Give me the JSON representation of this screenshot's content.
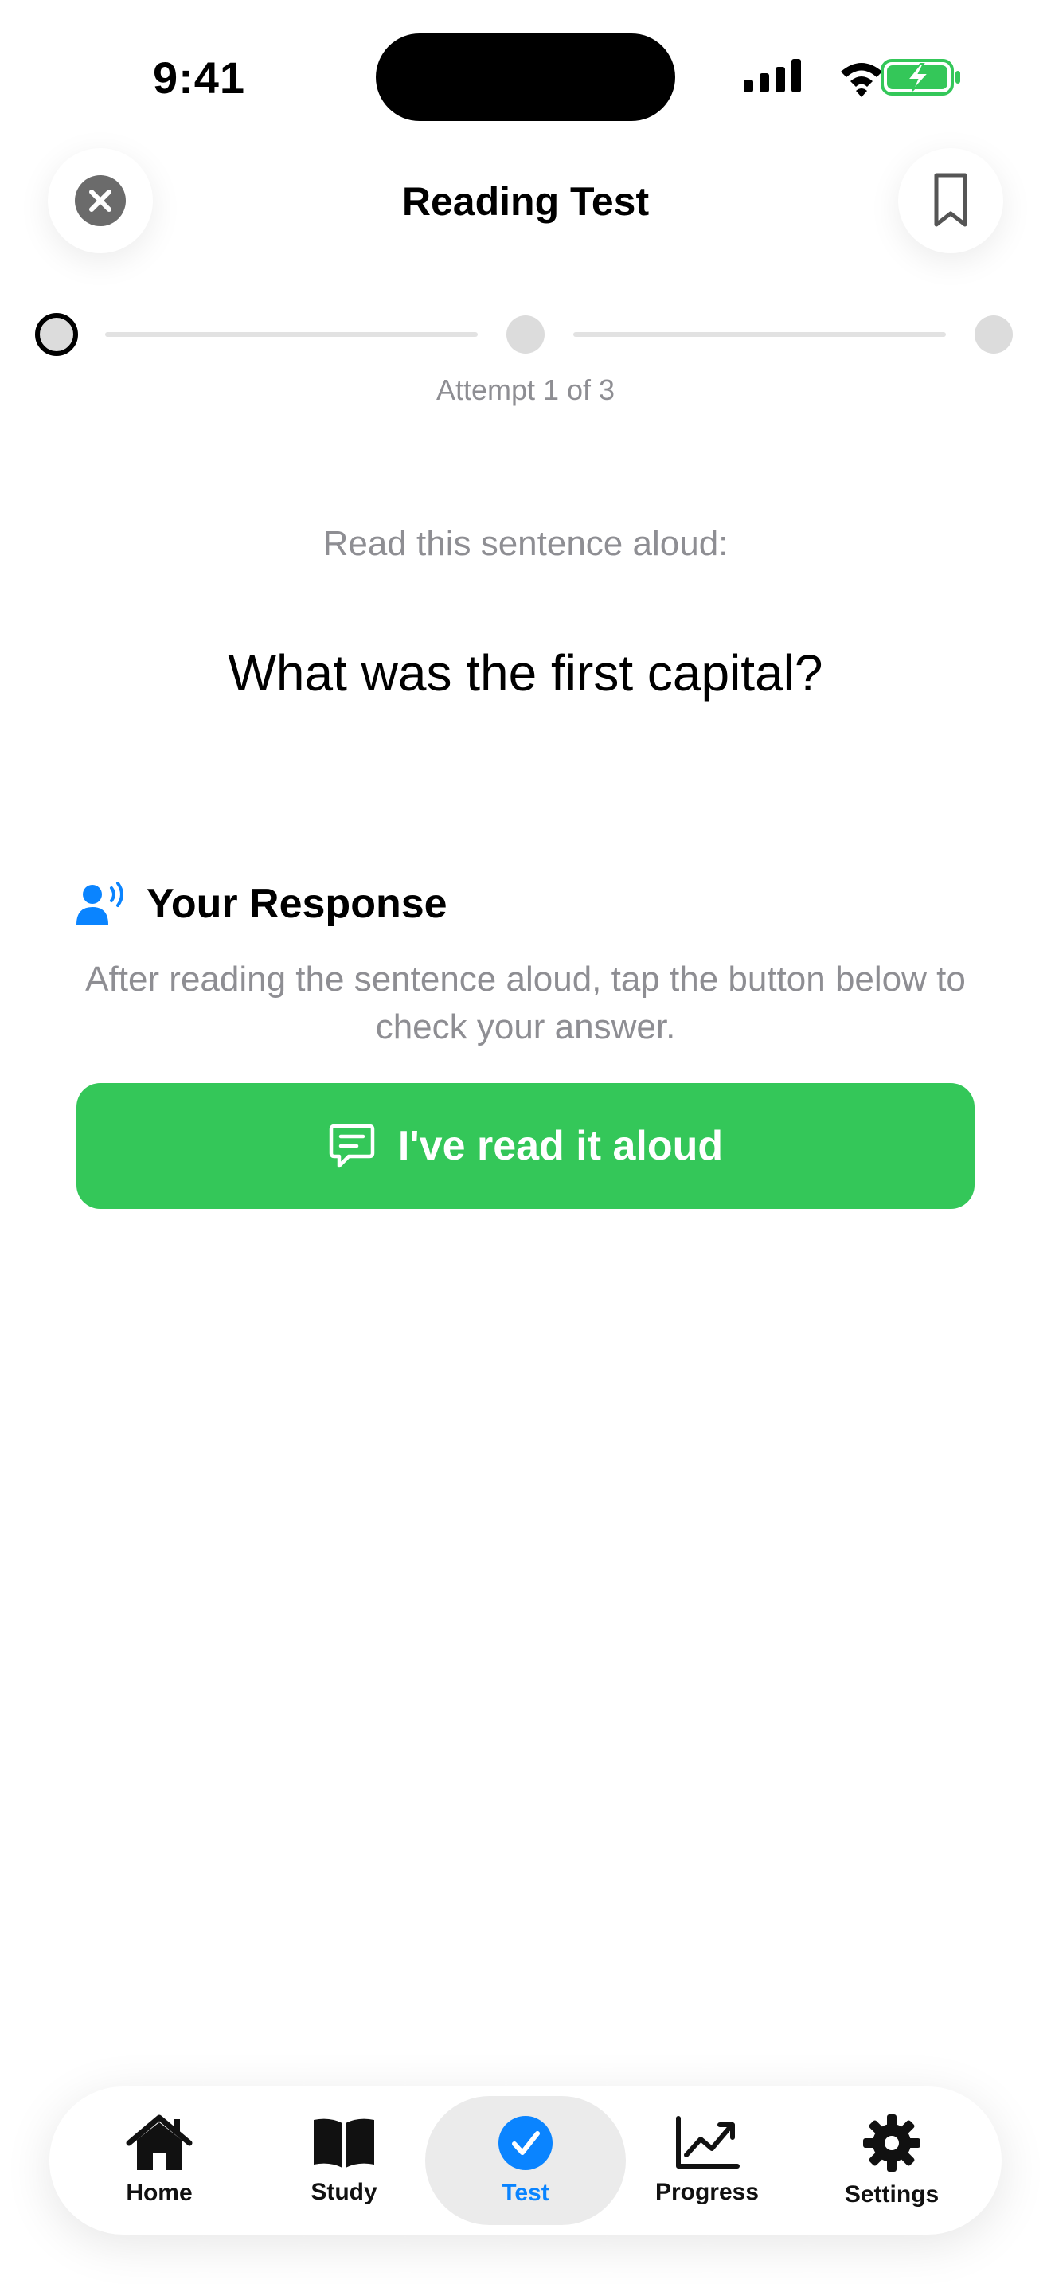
{
  "status_bar": {
    "time": "9:41"
  },
  "header": {
    "title": "Reading Test"
  },
  "progress": {
    "attempt_text": "Attempt 1 of 3",
    "current_step": 1,
    "total_steps": 3
  },
  "main": {
    "prompt": "Read this sentence aloud:",
    "sentence": "What was the first capital?",
    "response_title": "Your Response",
    "instructions": "After reading the sentence aloud, tap the button below to check your answer.",
    "primary_button": "I've read it aloud"
  },
  "tabs": [
    {
      "label": "Home",
      "icon": "house-icon",
      "active": false
    },
    {
      "label": "Study",
      "icon": "book-icon",
      "active": false
    },
    {
      "label": "Test",
      "icon": "checkmark-circle-icon",
      "active": true
    },
    {
      "label": "Progress",
      "icon": "chart-icon",
      "active": false
    },
    {
      "label": "Settings",
      "icon": "gear-icon",
      "active": false
    }
  ],
  "colors": {
    "accent": "#0a84ff",
    "primary_button": "#34c759",
    "secondary_text": "#8e8e93"
  }
}
